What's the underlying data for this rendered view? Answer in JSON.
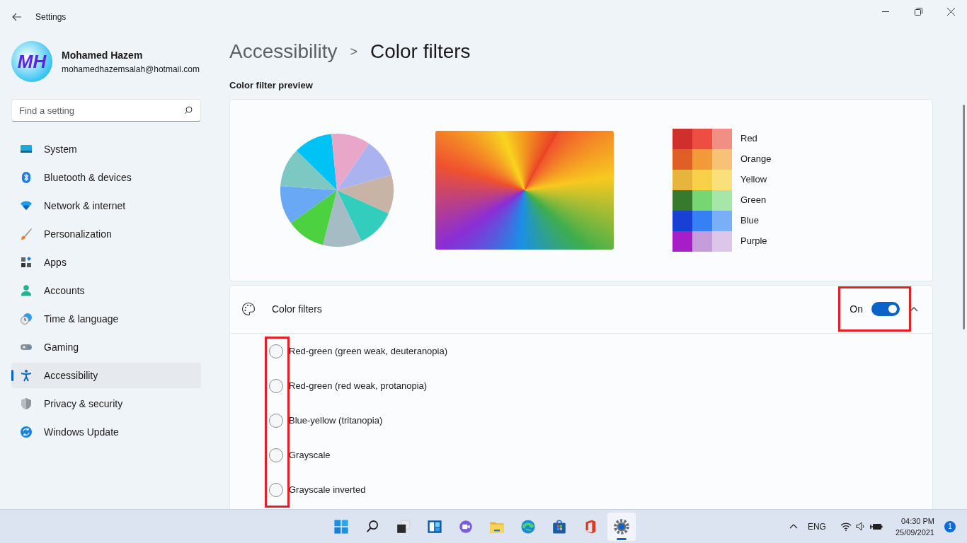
{
  "window": {
    "title": "Settings"
  },
  "user": {
    "name": "Mohamed Hazem",
    "email": "mohamedhazemsalah@hotmail.com",
    "initials": "MH"
  },
  "search": {
    "placeholder": "Find a setting"
  },
  "sidebar": {
    "items": [
      {
        "label": "System",
        "selected": false
      },
      {
        "label": "Bluetooth & devices",
        "selected": false
      },
      {
        "label": "Network & internet",
        "selected": false
      },
      {
        "label": "Personalization",
        "selected": false
      },
      {
        "label": "Apps",
        "selected": false
      },
      {
        "label": "Accounts",
        "selected": false
      },
      {
        "label": "Time & language",
        "selected": false
      },
      {
        "label": "Gaming",
        "selected": false
      },
      {
        "label": "Accessibility",
        "selected": true
      },
      {
        "label": "Privacy & security",
        "selected": false
      },
      {
        "label": "Windows Update",
        "selected": false
      }
    ]
  },
  "breadcrumb": {
    "parent": "Accessibility",
    "separator": ">",
    "current": "Color filters"
  },
  "preview": {
    "heading": "Color filter preview",
    "swatches": [
      {
        "label": "Red"
      },
      {
        "label": "Orange"
      },
      {
        "label": "Yellow"
      },
      {
        "label": "Green"
      },
      {
        "label": "Blue"
      },
      {
        "label": "Purple"
      }
    ]
  },
  "color_filters": {
    "label": "Color filters",
    "state_label": "On",
    "on": true,
    "expanded": true,
    "highlighted": true,
    "options_highlighted": true,
    "options": [
      {
        "label": "Red-green (green weak, deuteranopia)",
        "selected": false
      },
      {
        "label": "Red-green (red weak, protanopia)",
        "selected": false
      },
      {
        "label": "Blue-yellow (tritanopia)",
        "selected": false
      },
      {
        "label": "Grayscale",
        "selected": false
      },
      {
        "label": "Grayscale inverted",
        "selected": false
      }
    ]
  },
  "taskbar": {
    "apps": [
      {
        "selected": false
      },
      {
        "selected": false
      },
      {
        "selected": false
      },
      {
        "selected": false
      },
      {
        "selected": false
      },
      {
        "selected": false
      },
      {
        "selected": false
      },
      {
        "selected": false
      },
      {
        "selected": false
      },
      {
        "selected": true
      }
    ],
    "language": "ENG",
    "time": "04:30 PM",
    "date": "25/09/2021",
    "notifications": "1"
  }
}
